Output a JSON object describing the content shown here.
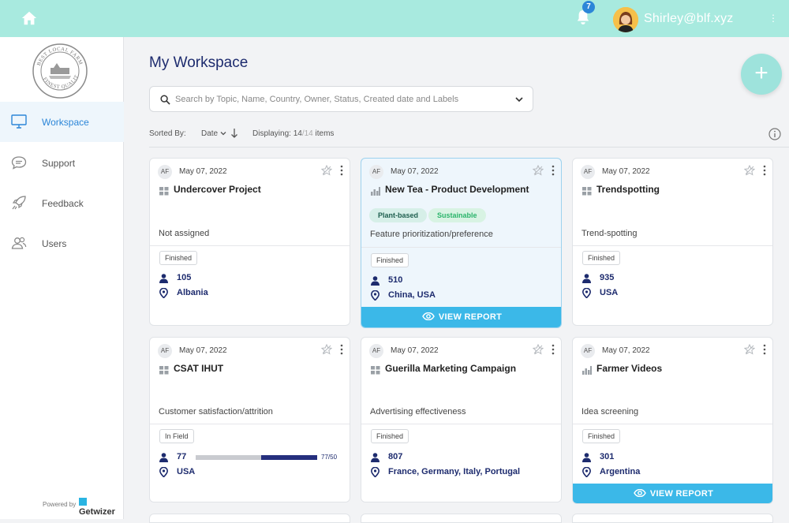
{
  "header": {
    "notification_count": "7",
    "user_email": "Shirley@blf.xyz",
    "user_menu_glyph": "⋮"
  },
  "sidebar": {
    "logo_alt": "Best Local Farm - Finest Quality",
    "items": [
      {
        "label": "Workspace",
        "icon": "monitor-icon",
        "active": true
      },
      {
        "label": "Support",
        "icon": "chat-bubble-icon",
        "active": false
      },
      {
        "label": "Feedback",
        "icon": "rocket-icon",
        "active": false
      },
      {
        "label": "Users",
        "icon": "users-icon",
        "active": false
      }
    ],
    "powered_by": "Powered by",
    "brand": "Getwizer"
  },
  "main": {
    "title": "My Workspace",
    "add_button": "+",
    "search_placeholder": "Search by Topic, Name, Country, Owner, Status, Created date and Labels",
    "sorted_by_label": "Sorted By:",
    "sort_value": "Date",
    "displaying_label": "Displaying:",
    "displaying_count": "14",
    "displaying_total": "/14",
    "displaying_suffix": "items"
  },
  "view_report_label": "VIEW REPORT",
  "colors": {
    "topbar": "#a8eadf",
    "accent": "#2c86d8",
    "navy": "#1d2b6e",
    "button": "#3bb8e8"
  },
  "cards": [
    {
      "initials": "AF",
      "date": "May 07, 2022",
      "type_icon": "grid-icon",
      "title": "Undercover Project",
      "tags": [],
      "description": "Not assigned",
      "status": "Finished",
      "respondents": "105",
      "location": "Albania"
    },
    {
      "initials": "AF",
      "date": "May 07, 2022",
      "type_icon": "bar-chart-icon",
      "title": "New Tea - Product Development",
      "tags": [
        "Plant-based",
        "Sustainable"
      ],
      "description": "Feature prioritization/preference",
      "status": "Finished",
      "respondents": "510",
      "location": "China, USA",
      "view_report": true
    },
    {
      "initials": "AF",
      "date": "May 07, 2022",
      "type_icon": "grid-icon",
      "title": "Trendspotting",
      "tags": [],
      "description": "Trend-spotting",
      "status": "Finished",
      "respondents": "935",
      "location": "USA"
    },
    {
      "initials": "AF",
      "date": "May 07, 2022",
      "type_icon": "grid-icon",
      "title": "CSAT IHUT",
      "tags": [],
      "description": "Customer satisfaction/attrition",
      "status": "In Field",
      "respondents": "77",
      "progress_text": "77/50",
      "progress_fraction": 0.46,
      "location": "USA"
    },
    {
      "initials": "AF",
      "date": "May 07, 2022",
      "type_icon": "grid-icon",
      "title": "Guerilla Marketing Campaign",
      "tags": [],
      "description": "Advertising effectiveness",
      "status": "Finished",
      "respondents": "807",
      "location": "France, Germany, Italy, Portugal"
    },
    {
      "initials": "AF",
      "date": "May 07, 2022",
      "type_icon": "bar-chart-icon",
      "title": "Farmer Videos",
      "tags": [],
      "description": "Idea screening",
      "status": "Finished",
      "respondents": "301",
      "location": "Argentina",
      "view_report": true
    }
  ]
}
